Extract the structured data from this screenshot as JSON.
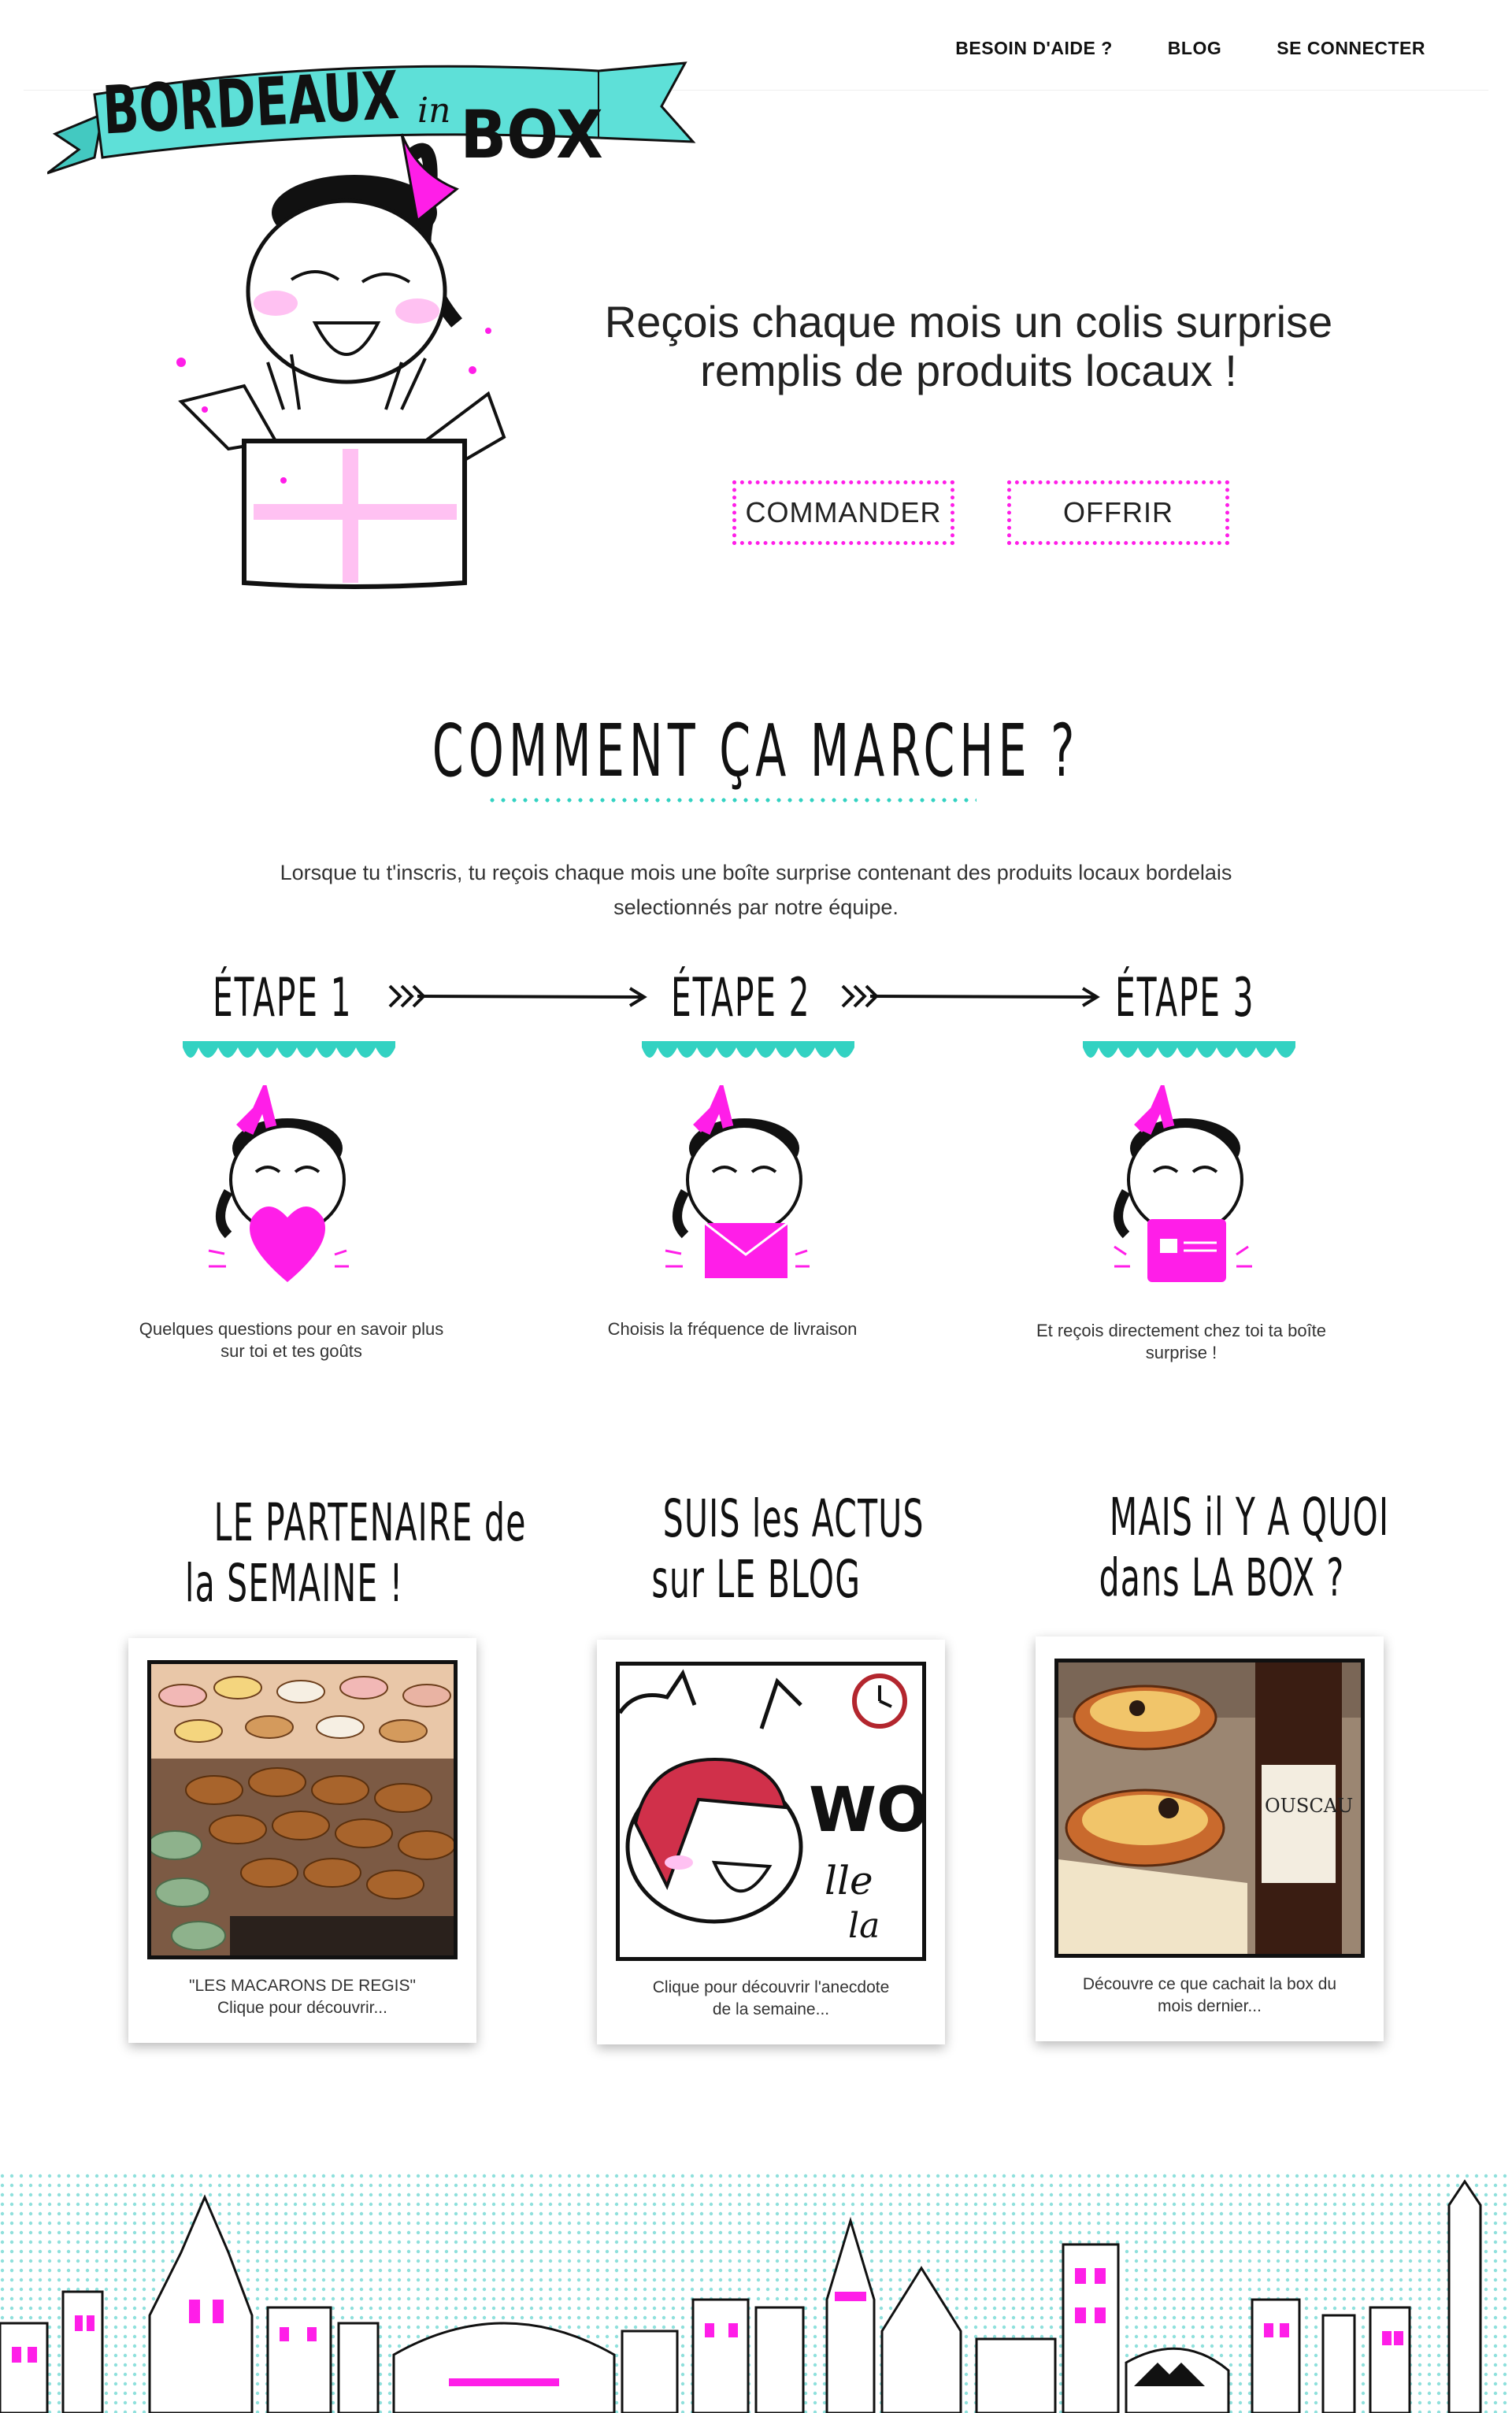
{
  "nav": {
    "help": "BESOIN D'AIDE ?",
    "blog": "BLOG",
    "login": "SE CONNECTER"
  },
  "logo": {
    "word1": "BORDEAUX",
    "word2": "in",
    "word3": "BOX"
  },
  "hero": {
    "tagline_line1": "Reçois chaque mois un colis surprise",
    "tagline_line2": "remplis de produits locaux !",
    "order_button": "COMMANDER",
    "gift_button": "OFFRIR"
  },
  "how": {
    "title": "COMMENT ÇA MARCHE ?",
    "intro_line1": "Lorsque tu t'inscris, tu reçois chaque mois une boîte surprise contenant des produits locaux bordelais",
    "intro_line2": "selectionnés par notre équipe.",
    "steps": [
      {
        "title": "ÉTAPE 1",
        "caption_line1": "Quelques questions pour en savoir plus",
        "caption_line2": "sur toi et tes goûts",
        "icon": "heart-icon"
      },
      {
        "title": "ÉTAPE 2",
        "caption_line1": "Choisis la fréquence de livraison",
        "caption_line2": "",
        "icon": "envelope-icon"
      },
      {
        "title": "ÉTAPE 3",
        "caption_line1": "Et reçois directement chez toi ta boîte",
        "caption_line2": "surprise !",
        "icon": "box-icon"
      }
    ]
  },
  "cards": [
    {
      "title_line1": "LE PARTENAIRE de",
      "title_line2": "la SEMAINE !",
      "caption_line1": "\"LES MACARONS DE REGIS\"",
      "caption_line2": "Clique pour découvrir...",
      "image": "macarons-photo"
    },
    {
      "title_line1": "SUIS les ACTUS",
      "title_line2": "sur LE BLOG",
      "caption_line1": "Clique pour découvrir l'anecdote",
      "caption_line2": "de la semaine...",
      "image": "blog-illustration",
      "illustration_text": "WOO",
      "illustration_text2": "lle",
      "illustration_text3": "la"
    },
    {
      "title_line1": "MAIS il Y A QUOI",
      "title_line2": "dans LA BOX ?",
      "caption_line1": "Découvre ce que cachait la box du",
      "caption_line2": "mois dernier...",
      "image": "box-contents-photo",
      "bottle_label": "OUSCAU"
    }
  ],
  "colors": {
    "pink": "#ff1ee8",
    "teal": "#33d2c2",
    "ribbon": "#5ee0d8"
  }
}
